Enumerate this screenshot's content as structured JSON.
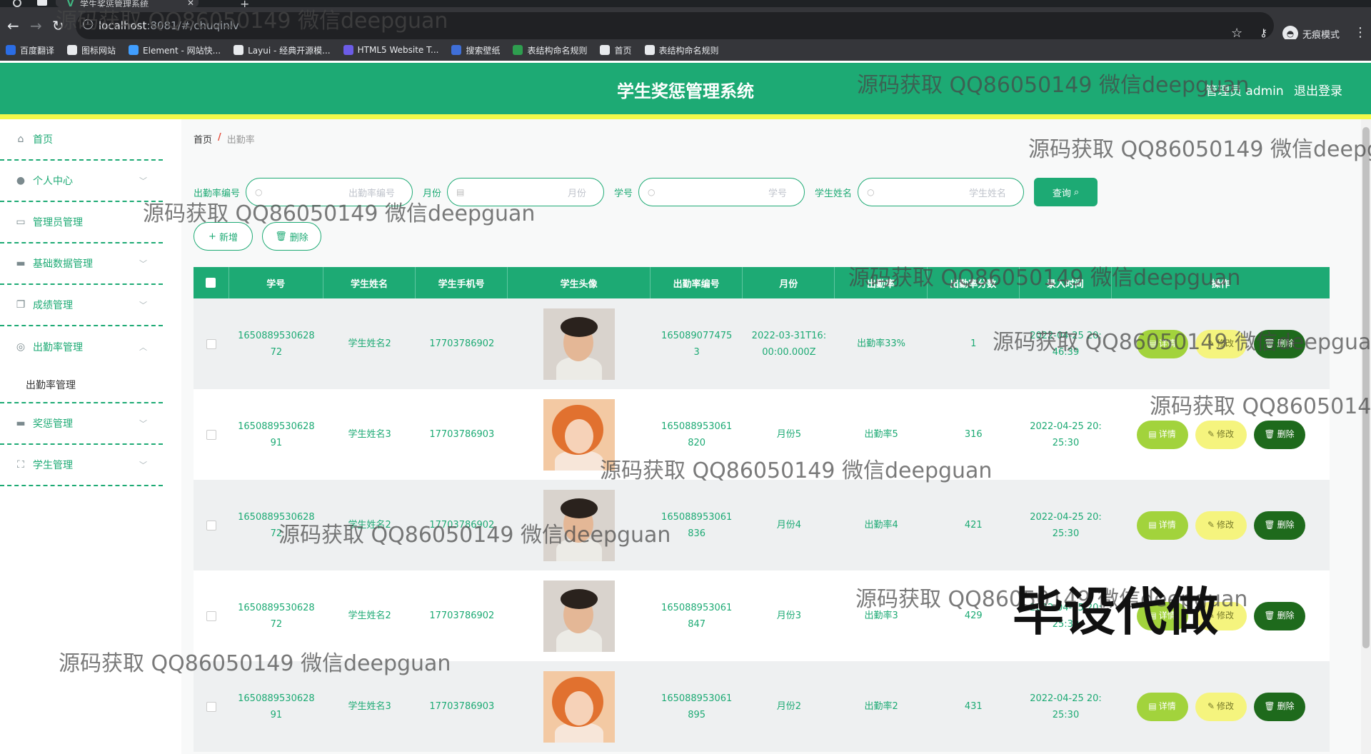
{
  "browser": {
    "tab_title": "学生奖惩管理系统",
    "url_host": "localhost",
    "url_rest": ":8081/#/chuqinlv",
    "incognito_label": "无痕模式",
    "bookmarks": [
      {
        "label": "百度翻译",
        "color": "#2b6de5"
      },
      {
        "label": "图标网站",
        "color": "#e8eaed"
      },
      {
        "label": "Element - 网站快...",
        "color": "#409eff"
      },
      {
        "label": "Layui - 经典开源模...",
        "color": "#e8eaed"
      },
      {
        "label": "HTML5 Website T...",
        "color": "#6c5ce7"
      },
      {
        "label": "搜索壁纸",
        "color": "#3f6fd8"
      },
      {
        "label": "表结构命名规则",
        "color": "#2e9e4f"
      },
      {
        "label": "首页",
        "color": "#e8eaed"
      },
      {
        "label": "表结构命名规则",
        "color": "#e8eaed"
      }
    ]
  },
  "header": {
    "title": "学生奖惩管理系统",
    "admin_label": "管理员 admin",
    "logout_label": "退出登录",
    "bg_color": "#1daa74",
    "strip_color": "#f2f84a"
  },
  "sidebar": {
    "items": [
      {
        "label": "首页",
        "icon": "home-icon",
        "has_children": false
      },
      {
        "label": "个人中心",
        "icon": "user-icon",
        "has_children": true
      },
      {
        "label": "管理员管理",
        "icon": "chat-icon",
        "has_children": false
      },
      {
        "label": "基础数据管理",
        "icon": "message-icon",
        "has_children": true
      },
      {
        "label": "成绩管理",
        "icon": "copy-icon",
        "has_children": true
      },
      {
        "label": "出勤率管理",
        "icon": "globe-icon",
        "has_children": true,
        "open": true,
        "children": [
          "出勤率管理"
        ]
      },
      {
        "label": "奖惩管理",
        "icon": "message-icon",
        "has_children": true
      },
      {
        "label": "学生管理",
        "icon": "fullscreen-icon",
        "has_children": true
      }
    ]
  },
  "breadcrumb": {
    "home": "首页",
    "separator": "/",
    "current": "出勤率"
  },
  "search": {
    "fields": [
      {
        "label": "出勤率编号",
        "placeholder": "出勤率编号",
        "icon": "search-icon"
      },
      {
        "label": "月份",
        "placeholder": "月份",
        "icon": "calendar-icon"
      },
      {
        "label": "学号",
        "placeholder": "学号",
        "icon": "search-icon"
      },
      {
        "label": "学生姓名",
        "placeholder": "学生姓名",
        "icon": "search-icon"
      }
    ],
    "button_label": "查询"
  },
  "actions": {
    "add_label": "新增",
    "delete_label": "删除"
  },
  "table": {
    "columns": [
      "学号",
      "学生姓名",
      "学生手机号",
      "学生头像",
      "出勤率编号",
      "月份",
      "出勤率",
      "出勤率分数",
      "录入时间",
      "操作"
    ],
    "rows": [
      {
        "student_no": "165088953062872",
        "name": "学生姓名2",
        "phone": "17703786902",
        "avatar": "male",
        "record_no": "1650890774753",
        "month": "2022-03-31T16:00:00.000Z",
        "rate": "出勤率33%",
        "score": "1",
        "created": "2022-04-25 20:46:39"
      },
      {
        "student_no": "165088953062891",
        "name": "学生姓名3",
        "phone": "17703786903",
        "avatar": "female",
        "record_no": "165088953061820",
        "month": "月份5",
        "rate": "出勤率5",
        "score": "316",
        "created": "2022-04-25 20:25:30"
      },
      {
        "student_no": "165088953062872",
        "name": "学生姓名2",
        "phone": "17703786902",
        "avatar": "male",
        "record_no": "165088953061836",
        "month": "月份4",
        "rate": "出勤率4",
        "score": "421",
        "created": "2022-04-25 20:25:30"
      },
      {
        "student_no": "165088953062872",
        "name": "学生姓名2",
        "phone": "17703786902",
        "avatar": "male",
        "record_no": "165088953061847",
        "month": "月份3",
        "rate": "出勤率3",
        "score": "429",
        "created": "2022-04-25 20:25:30"
      },
      {
        "student_no": "165088953062891",
        "name": "学生姓名3",
        "phone": "17703786903",
        "avatar": "female",
        "record_no": "165088953061895",
        "month": "月份2",
        "rate": "出勤率2",
        "score": "431",
        "created": "2022-04-25 20:25:30"
      }
    ],
    "op_labels": {
      "detail": "详情",
      "edit": "修改",
      "delete": "删除"
    }
  },
  "watermarks": {
    "text": "源码获取 QQ86050149 微信deepguan",
    "big_text": "毕设代做"
  }
}
